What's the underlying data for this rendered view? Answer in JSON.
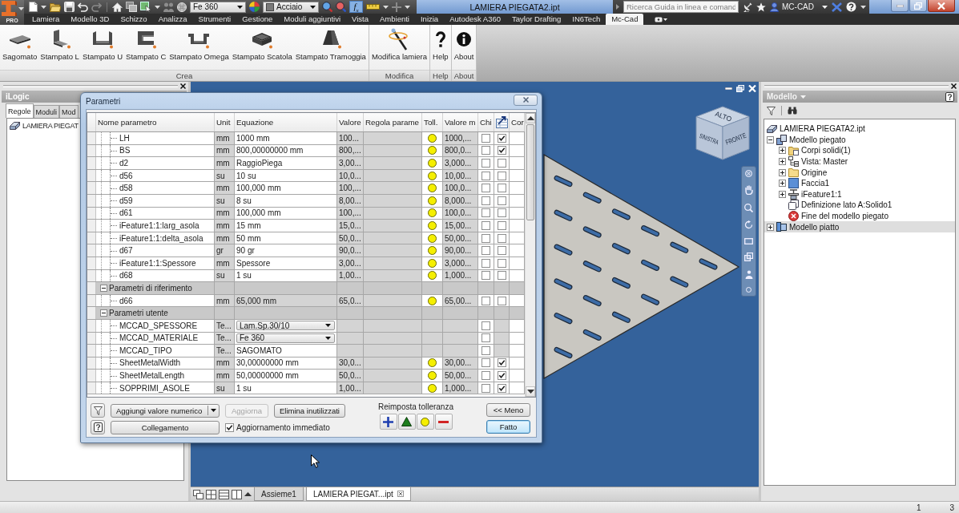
{
  "app_button": {
    "badge": "PRO"
  },
  "quick_access": {
    "material": "Fe 360",
    "appearance": "Acciaio",
    "functions_label": "f$_{x}$"
  },
  "window": {
    "title": "LAMIERA PIEGATA2.ipt"
  },
  "help_search": {
    "placeholder": "Ricerca Guida in linea e comand"
  },
  "user": {
    "name": "MC-CAD"
  },
  "ribbon": {
    "tabs": [
      {
        "label": "Lamiera",
        "selected": false
      },
      {
        "label": "Modello 3D",
        "selected": false
      },
      {
        "label": "Schizzo",
        "selected": false
      },
      {
        "label": "Analizza",
        "selected": false
      },
      {
        "label": "Strumenti",
        "selected": false
      },
      {
        "label": "Gestione",
        "selected": false
      },
      {
        "label": "Moduli aggiuntivi",
        "selected": false
      },
      {
        "label": "Vista",
        "selected": false
      },
      {
        "label": "Ambienti",
        "selected": false
      },
      {
        "label": "Inizia",
        "selected": false
      },
      {
        "label": "Autodesk A360",
        "selected": false
      },
      {
        "label": "Taylor Drafting",
        "selected": false
      },
      {
        "label": "IN6Tech",
        "selected": false
      },
      {
        "label": "Mc-Cad",
        "selected": true
      }
    ],
    "panels": [
      {
        "label": "Crea",
        "buttons": [
          {
            "label": "Sagomato",
            "kind": "flat"
          },
          {
            "label": "Stampato L",
            "kind": "l-profile"
          },
          {
            "label": "Stampato U",
            "kind": "u-profile"
          },
          {
            "label": "Stampato C",
            "kind": "c-profile"
          },
          {
            "label": "Stampato Omega",
            "kind": "omega-profile"
          },
          {
            "label": "Stampato Scatola",
            "kind": "box"
          },
          {
            "label": "Stampato Tramoggia",
            "kind": "hopper"
          }
        ]
      },
      {
        "label": "Modifica",
        "buttons": [
          {
            "label": "Modifica lamiera",
            "kind": "wand"
          }
        ]
      },
      {
        "label": "Help",
        "buttons": [
          {
            "label": "Help",
            "kind": "help"
          }
        ]
      },
      {
        "label": "About",
        "buttons": [
          {
            "label": "About",
            "kind": "info"
          }
        ]
      }
    ]
  },
  "ilogic_panel": {
    "title": "iLogic",
    "tabs": [
      {
        "label": "Regole",
        "selected": true
      },
      {
        "label": "Moduli",
        "selected": false
      },
      {
        "label": "Mod",
        "selected": false
      }
    ],
    "tree": [
      {
        "label": "LAMIERA PIEGAT"
      }
    ]
  },
  "viewport": {
    "view_cube": {
      "faces": [
        {
          "kind": "top",
          "label": "ALTO"
        },
        {
          "kind": "left",
          "label": "SINISTRA"
        },
        {
          "kind": "right",
          "label": "FRONTE"
        }
      ]
    },
    "document_tabs": [
      {
        "label": "Assieme1",
        "selected": false
      },
      {
        "label": "LAMIERA PIEGAT...ipt",
        "selected": true
      }
    ]
  },
  "model_panel": {
    "title": "Modello",
    "tree": [
      {
        "label": "LAMIERA PIEGATA2.ipt",
        "kind": "part",
        "selected": false,
        "children": [
          {
            "label": "Modello piegato",
            "kind": "folded-model",
            "expanded": true,
            "selected": false,
            "children": [
              {
                "label": "Corpi solidi(1)",
                "kind": "bodies",
                "expanded": false,
                "selected": false
              },
              {
                "label": "Vista: Master",
                "kind": "view",
                "expanded": false,
                "selected": false
              },
              {
                "label": "Origine",
                "kind": "folder",
                "expanded": false,
                "selected": false
              },
              {
                "label": "Faccia1",
                "kind": "face",
                "expanded": false,
                "selected": false
              },
              {
                "label": "iFeature1:1",
                "kind": "feature",
                "expanded": false,
                "selected": false
              },
              {
                "label": "Definizione lato A:Solido1",
                "kind": "side",
                "selected": false
              },
              {
                "label": "Fine del modello piegato",
                "kind": "end",
                "selected": false
              }
            ]
          },
          {
            "label": "Modello piatto",
            "kind": "flat-model",
            "expanded": false,
            "selected": true
          }
        ]
      }
    ]
  },
  "parameters_dialog": {
    "title": "Parametri",
    "columns": [
      {
        "kind": "text",
        "label": "Nome parametro"
      },
      {
        "kind": "text",
        "label": "Unit"
      },
      {
        "kind": "text",
        "label": "Equazione"
      },
      {
        "kind": "text",
        "label": "Valore"
      },
      {
        "kind": "text",
        "label": "Regola parame"
      },
      {
        "kind": "text",
        "label": "Toll."
      },
      {
        "kind": "text",
        "label": "Valore m"
      },
      {
        "kind": "text",
        "label": "Chi"
      },
      {
        "kind": "icon"
      },
      {
        "kind": "text",
        "label": "Cor"
      }
    ],
    "groups": [
      {
        "children": [
          {
            "kind": "numeric",
            "name": "LH",
            "unit": "mm",
            "equation": "1000 mm",
            "read_only": false,
            "value": "100...",
            "tolerance": {
              "kind": "nominal"
            },
            "model_value": "1000,...",
            "key": false,
            "export": true
          },
          {
            "kind": "numeric",
            "name": "BS",
            "unit": "mm",
            "equation": "800,00000000 mm",
            "read_only": false,
            "value": "800,...",
            "tolerance": {
              "kind": "nominal"
            },
            "model_value": "800,0...",
            "key": false,
            "export": true
          },
          {
            "kind": "numeric",
            "name": "d2",
            "unit": "mm",
            "equation": "RaggioPiega",
            "read_only": false,
            "value": "3,00...",
            "tolerance": {
              "kind": "nominal"
            },
            "model_value": "3,000...",
            "key": false,
            "export": false
          },
          {
            "kind": "numeric",
            "name": "d56",
            "unit": "su",
            "equation": "10 su",
            "read_only": false,
            "value": "10,0...",
            "tolerance": {
              "kind": "nominal"
            },
            "model_value": "10,00...",
            "key": false,
            "export": false
          },
          {
            "kind": "numeric",
            "name": "d58",
            "unit": "mm",
            "equation": "100,000 mm",
            "read_only": false,
            "value": "100,...",
            "tolerance": {
              "kind": "nominal"
            },
            "model_value": "100,0...",
            "key": false,
            "export": false
          },
          {
            "kind": "numeric",
            "name": "d59",
            "unit": "su",
            "equation": "8 su",
            "read_only": false,
            "value": "8,00...",
            "tolerance": {
              "kind": "nominal"
            },
            "model_value": "8,000...",
            "key": false,
            "export": false
          },
          {
            "kind": "numeric",
            "name": "d61",
            "unit": "mm",
            "equation": "100,000 mm",
            "read_only": false,
            "value": "100,...",
            "tolerance": {
              "kind": "nominal"
            },
            "model_value": "100,0...",
            "key": false,
            "export": false
          },
          {
            "kind": "numeric",
            "name": "iFeature1:1:larg_asola",
            "unit": "mm",
            "equation": "15 mm",
            "read_only": false,
            "value": "15,0...",
            "tolerance": {
              "kind": "nominal"
            },
            "model_value": "15,00...",
            "key": false,
            "export": false
          },
          {
            "kind": "numeric",
            "name": "iFeature1:1:delta_asola",
            "unit": "mm",
            "equation": "50 mm",
            "read_only": false,
            "value": "50,0...",
            "tolerance": {
              "kind": "nominal"
            },
            "model_value": "50,00...",
            "key": false,
            "export": false
          },
          {
            "kind": "numeric",
            "name": "d67",
            "unit": "gr",
            "equation": "90 gr",
            "read_only": false,
            "value": "90,0...",
            "tolerance": {
              "kind": "nominal"
            },
            "model_value": "90,00...",
            "key": false,
            "export": false
          },
          {
            "kind": "numeric",
            "name": "iFeature1:1:Spessore",
            "unit": "mm",
            "equation": "Spessore",
            "read_only": false,
            "value": "3,00...",
            "tolerance": {
              "kind": "nominal"
            },
            "model_value": "3,000...",
            "key": false,
            "export": false
          },
          {
            "kind": "numeric",
            "name": "d68",
            "unit": "su",
            "equation": "1 su",
            "read_only": false,
            "value": "1,00...",
            "tolerance": {
              "kind": "nominal"
            },
            "model_value": "1,000...",
            "key": false,
            "export": false
          }
        ]
      },
      {
        "label": "Parametri di riferimento",
        "expanded": true,
        "children": [
          {
            "kind": "numeric",
            "name": "d66",
            "unit": "mm",
            "equation": "65,000 mm",
            "read_only": true,
            "value": "65,0...",
            "tolerance": {
              "kind": "nominal"
            },
            "model_value": "65,00...",
            "key": false,
            "export": false
          }
        ]
      },
      {
        "label": "Parametri utente",
        "expanded": true,
        "children": [
          {
            "kind": "dropdown",
            "name": "MCCAD_SPESSORE",
            "unit": "Te...",
            "equation": "Lam.Sp.30/10",
            "read_only": false,
            "key": false
          },
          {
            "kind": "dropdown",
            "name": "MCCAD_MATERIALE",
            "unit": "Te...",
            "equation": "Fe 360",
            "read_only": false,
            "key": false
          },
          {
            "kind": "text",
            "name": "MCCAD_TIPO",
            "unit": "Te...",
            "equation": "SAGOMATO",
            "read_only": false,
            "key": false
          },
          {
            "kind": "numeric",
            "name": "SheetMetalWidth",
            "unit": "mm",
            "equation": "30,00000000 mm",
            "read_only": false,
            "value": "30,0...",
            "tolerance": {
              "kind": "nominal"
            },
            "model_value": "30,00...",
            "key": false,
            "export": true
          },
          {
            "kind": "numeric",
            "name": "SheetMetalLength",
            "unit": "mm",
            "equation": "50,00000000 mm",
            "read_only": false,
            "value": "50,0...",
            "tolerance": {
              "kind": "nominal"
            },
            "model_value": "50,00...",
            "key": false,
            "export": true
          },
          {
            "kind": "numeric",
            "name": "SOPPRIMI_ASOLE",
            "unit": "su",
            "equation": "1 su",
            "read_only": false,
            "value": "1,00...",
            "tolerance": {
              "kind": "nominal"
            },
            "model_value": "1,000...",
            "key": false,
            "export": true
          }
        ]
      }
    ],
    "footer": {
      "add_button": {
        "label": "Aggiungi valore numerico"
      },
      "update_button": {
        "label": "Aggiorna",
        "disabled": true
      },
      "purge_button": {
        "label": "Elimina inutilizzati"
      },
      "link_button": {
        "label": "Collegamento"
      },
      "immediate_update": {
        "label": "Aggiornamento immediato",
        "checked": true
      },
      "tolerance_reset": {
        "label": "Reimposta tolleranza",
        "options": [
          {
            "kind": "upper"
          },
          {
            "kind": "median"
          },
          {
            "kind": "nominal"
          },
          {
            "kind": "lower"
          }
        ]
      },
      "less_button": {
        "label": "<< Meno"
      },
      "done_button": {
        "label": "Fatto",
        "default": true
      }
    }
  },
  "status_bar": {
    "counts": [
      "1",
      "3"
    ]
  }
}
